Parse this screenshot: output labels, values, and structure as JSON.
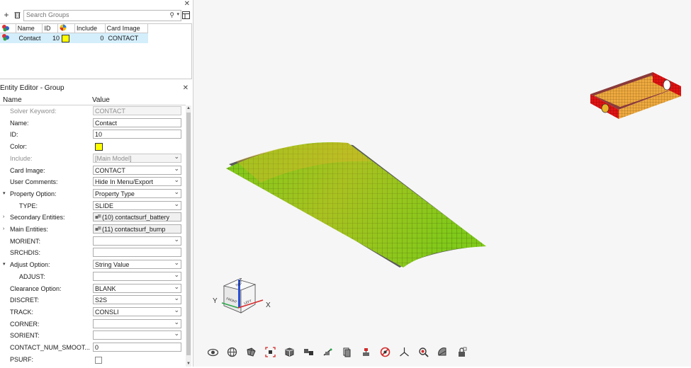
{
  "groups_panel": {
    "search_placeholder": "Search Groups",
    "columns": [
      "Name",
      "ID",
      "",
      "Include",
      "Card Image"
    ],
    "row": {
      "name": "Contact",
      "id": "10",
      "color": "#ffff00",
      "include": "0",
      "card_image": "CONTACT"
    }
  },
  "entity_editor": {
    "title": "Entity Editor - Group",
    "columns": [
      "Name",
      "Value"
    ],
    "rows": [
      {
        "label": "Solver Keyword:",
        "value": "CONTACT",
        "kind": "text",
        "disabled": true
      },
      {
        "label": "Name:",
        "value": "Contact",
        "kind": "text"
      },
      {
        "label": "ID:",
        "value": "10",
        "kind": "text"
      },
      {
        "label": "Color:",
        "value": "",
        "kind": "color",
        "color": "#ffff00"
      },
      {
        "label": "Include:",
        "value": "[Main Model]",
        "kind": "dropdown",
        "disabled": true
      },
      {
        "label": "Card Image:",
        "value": "CONTACT",
        "kind": "dropdown"
      },
      {
        "label": "User Comments:",
        "value": "Hide In Menu/Export",
        "kind": "dropdown"
      },
      {
        "label": "Property Option:",
        "value": "Property Type",
        "kind": "dropdown",
        "expander": "▾"
      },
      {
        "label": "TYPE:",
        "value": "SLIDE",
        "kind": "dropdown",
        "indent": true
      },
      {
        "label": "Secondary Entities:",
        "value": "(10) contactsurf_battery",
        "kind": "entity",
        "expander": "›"
      },
      {
        "label": "Main Entities:",
        "value": "(11) contactsurf_bump",
        "kind": "entity",
        "expander": "›"
      },
      {
        "label": "MORIENT:",
        "value": "",
        "kind": "dropdown"
      },
      {
        "label": "SRCHDIS:",
        "value": "",
        "kind": "text"
      },
      {
        "label": "Adjust Option:",
        "value": "String Value",
        "kind": "dropdown",
        "expander": "▾"
      },
      {
        "label": "ADJUST:",
        "value": "",
        "kind": "dropdown",
        "indent": true
      },
      {
        "label": "Clearance Option:",
        "value": "BLANK",
        "kind": "dropdown"
      },
      {
        "label": "DISCRET:",
        "value": "S2S",
        "kind": "dropdown"
      },
      {
        "label": "TRACK:",
        "value": "CONSLI",
        "kind": "dropdown"
      },
      {
        "label": "CORNER:",
        "value": "",
        "kind": "dropdown"
      },
      {
        "label": "SORIENT:",
        "value": "",
        "kind": "dropdown"
      },
      {
        "label": "CONTACT_NUM_SMOOT...",
        "value": "0",
        "kind": "text"
      },
      {
        "label": "PSURF:",
        "value": "",
        "kind": "checkbox"
      }
    ]
  },
  "triad": {
    "top": "TOP",
    "front": "FRONT",
    "left": "LEFT",
    "x": "X",
    "y": "Y",
    "z": "Z"
  },
  "toolbar": {
    "icons": [
      "view-eye-icon",
      "globe-icon",
      "mesh-icon",
      "fit-icon",
      "cube-icon",
      "assembly-icon",
      "section-cut-icon",
      "page-icon",
      "clip-icon",
      "no-entry-icon",
      "axis-icon",
      "zoom-icon",
      "fan-icon",
      "lock-icon"
    ]
  },
  "colors": {
    "selection": "#d4eefb",
    "mesh_yellow": "#e9b92a",
    "mesh_green": "#6fd21b",
    "mesh_red": "#e21010"
  }
}
